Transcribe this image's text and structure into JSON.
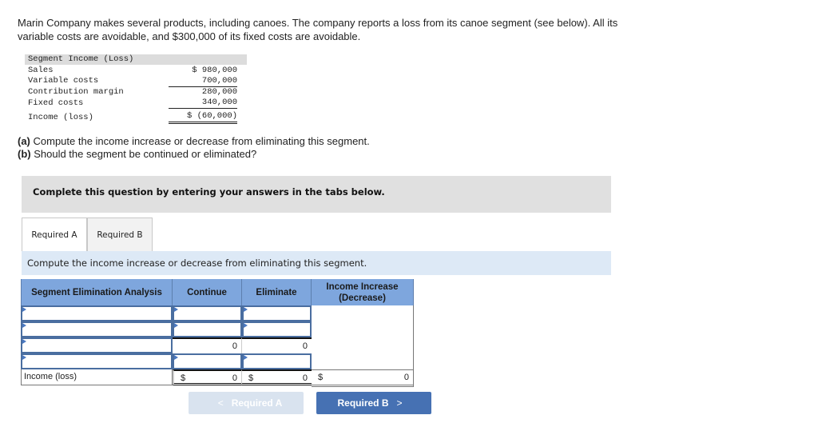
{
  "intro": "Marin Company makes several products, including canoes. The company reports a loss from its canoe segment (see below). All its variable costs are avoidable, and $300,000 of its fixed costs are avoidable.",
  "segment_table": {
    "title": "Segment Income (Loss)",
    "rows": [
      {
        "label": "Sales",
        "value": "$ 980,000"
      },
      {
        "label": "Variable costs",
        "value": "700,000"
      },
      {
        "label": "Contribution margin",
        "value": "280,000"
      },
      {
        "label": "Fixed costs",
        "value": "340,000"
      },
      {
        "label": "Income (loss)",
        "value": "$ (60,000)"
      }
    ]
  },
  "questions": {
    "a_tag": "(a)",
    "a_text": " Compute the income increase or decrease from eliminating this segment.",
    "b_tag": "(b)",
    "b_text": " Should the segment be continued or eliminated?"
  },
  "banner": "Complete this question by entering your answers in the tabs below.",
  "tabs": [
    {
      "label": "Required A",
      "active": true
    },
    {
      "label": "Required B",
      "active": false
    }
  ],
  "instruction": "Compute the income increase or decrease from eliminating this segment.",
  "analysis": {
    "headers": [
      "Segment Elimination Analysis",
      "Continue",
      "Eliminate",
      "Income Increase (Decrease)"
    ],
    "row3": {
      "continue": "0",
      "eliminate": "0"
    },
    "total": {
      "label": "Income (loss)",
      "currency": "$",
      "continue": "0",
      "eliminate": "0",
      "increase": "0"
    }
  },
  "nav": {
    "prev_label": "Required A",
    "prev_chevron": "<",
    "next_label": "Required B",
    "next_chevron": ">"
  },
  "colors": {
    "header_blue": "#7ea6dd",
    "input_border": "#4a6ea0",
    "next_button": "#4671b3",
    "prev_button_disabled": "#d9e3ef",
    "instruction_bg": "#dde9f6",
    "banner_bg": "#e0e0e0"
  }
}
